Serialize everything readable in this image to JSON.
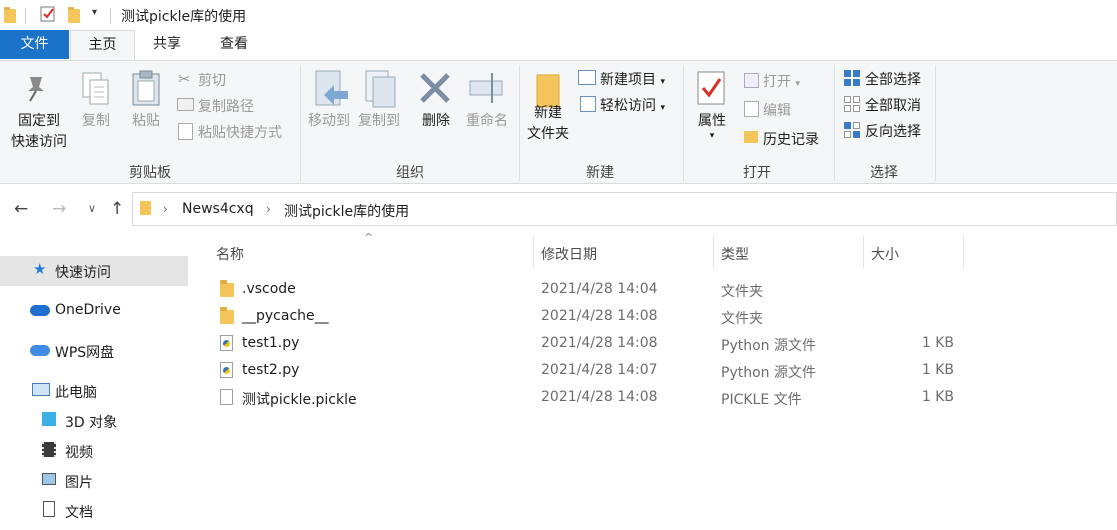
{
  "window": {
    "title": "测试pickle库的使用"
  },
  "tabs": [
    {
      "label": "文件"
    },
    {
      "label": "主页"
    },
    {
      "label": "共享"
    },
    {
      "label": "查看"
    }
  ],
  "ribbon": {
    "clipboard": {
      "group_label": "剪贴板",
      "pin_line1": "固定到",
      "pin_line2": "快速访问",
      "copy": "复制",
      "paste": "粘贴",
      "cut": "剪切",
      "copy_path": "复制路径",
      "paste_shortcut": "粘贴快捷方式"
    },
    "organize": {
      "group_label": "组织",
      "move_to": "移动到",
      "copy_to": "复制到",
      "delete": "删除",
      "rename": "重命名"
    },
    "new": {
      "group_label": "新建",
      "new_folder_line1": "新建",
      "new_folder_line2": "文件夹",
      "new_item": "新建项目",
      "easy_access": "轻松访问"
    },
    "open": {
      "group_label": "打开",
      "properties": "属性",
      "open": "打开",
      "edit": "编辑",
      "history": "历史记录"
    },
    "select": {
      "group_label": "选择",
      "select_all": "全部选择",
      "select_none": "全部取消",
      "invert": "反向选择"
    }
  },
  "address": {
    "crumbs": [
      "News4cxq",
      "测试pickle库的使用"
    ]
  },
  "nav": {
    "items": [
      {
        "label": "快速访问",
        "icon": "star-icon"
      },
      {
        "label": "OneDrive",
        "icon": "cloud-icon"
      },
      {
        "label": "WPS网盘",
        "icon": "cloud-icon"
      },
      {
        "label": "此电脑",
        "icon": "computer-icon"
      },
      {
        "label": "3D 对象",
        "icon": "cube-icon"
      },
      {
        "label": "视频",
        "icon": "video-icon"
      },
      {
        "label": "图片",
        "icon": "picture-icon"
      },
      {
        "label": "文档",
        "icon": "document-icon"
      }
    ]
  },
  "list": {
    "columns": {
      "name": "名称",
      "date": "修改日期",
      "type": "类型",
      "size": "大小"
    },
    "rows": [
      {
        "name": ".vscode",
        "date": "2021/4/28 14:04",
        "type": "文件夹",
        "size": "",
        "icon": "folder-icon"
      },
      {
        "name": "__pycache__",
        "date": "2021/4/28 14:08",
        "type": "文件夹",
        "size": "",
        "icon": "folder-icon"
      },
      {
        "name": "test1.py",
        "date": "2021/4/28 14:08",
        "type": "Python 源文件",
        "size": "1 KB",
        "icon": "python-file-icon"
      },
      {
        "name": "test2.py",
        "date": "2021/4/28 14:07",
        "type": "Python 源文件",
        "size": "1 KB",
        "icon": "python-file-icon"
      },
      {
        "name": "测试pickle.pickle",
        "date": "2021/4/28 14:08",
        "type": "PICKLE 文件",
        "size": "1 KB",
        "icon": "file-icon"
      }
    ]
  },
  "colors": {
    "accent": "#1a73c9",
    "ribbon_bg": "#f5f6f7",
    "nav_selected": "#e5e5e5"
  }
}
